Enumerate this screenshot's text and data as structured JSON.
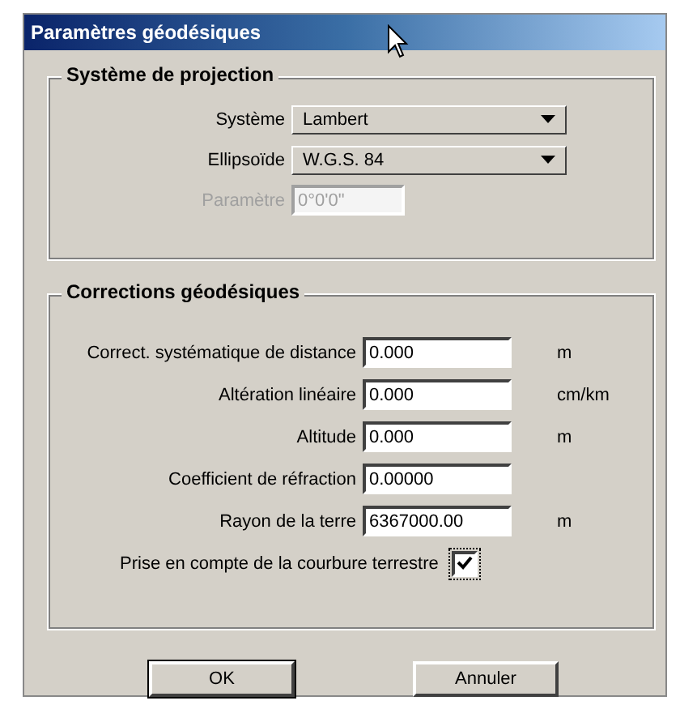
{
  "window": {
    "title": "Paramètres géodésiques"
  },
  "projection": {
    "title": "Système de projection",
    "fields": [
      {
        "kind": "dropdown",
        "label": "Système",
        "value": "Lambert",
        "disabled": false
      },
      {
        "kind": "dropdown",
        "label": "Ellipsoïde",
        "value": "W.G.S. 84",
        "disabled": false
      },
      {
        "kind": "text",
        "label": "Paramètre",
        "value": "0°0'0\"",
        "disabled": true
      }
    ]
  },
  "corrections": {
    "title": "Corrections géodésiques",
    "fields": [
      {
        "kind": "text",
        "label": "Correct. systématique de distance",
        "value": "0.000",
        "unit": "m"
      },
      {
        "kind": "text",
        "label": "Altération linéaire",
        "value": "0.000",
        "unit": "cm/km"
      },
      {
        "kind": "text",
        "label": "Altitude",
        "value": "0.000",
        "unit": "m"
      },
      {
        "kind": "text",
        "label": "Coefficient de réfraction",
        "value": "0.00000"
      },
      {
        "kind": "text",
        "label": "Rayon de la terre",
        "value": "6367000.00",
        "unit": "m"
      },
      {
        "kind": "checkbox",
        "label": "Prise en compte de la courbure terrestre",
        "checked": true
      }
    ]
  },
  "buttons": [
    {
      "label": "OK",
      "default": true
    },
    {
      "label": "Annuler",
      "default": false
    }
  ]
}
